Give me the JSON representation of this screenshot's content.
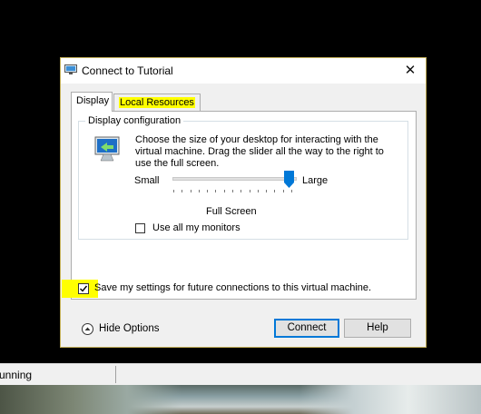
{
  "dialog": {
    "title": "Connect to Tutorial",
    "close_glyph": "✕",
    "tabs": [
      {
        "label": "Display",
        "active": true
      },
      {
        "label": "Local Resources",
        "active": false,
        "highlighted": true
      }
    ],
    "group_title": "Display configuration",
    "description": "Choose the size of your desktop for interacting with the virtual machine. Drag the slider all the way to the right to use the full screen.",
    "slider": {
      "min_label": "Small",
      "max_label": "Large",
      "value_label": "Full Screen",
      "value_fraction": 1.0
    },
    "use_all_monitors": {
      "label": "Use all my monitors",
      "checked": false
    },
    "save_settings": {
      "label": "Save my settings for future connections to this virtual machine.",
      "checked": true,
      "highlighted": true
    },
    "hide_options_label": "Hide Options",
    "connect_label": "Connect",
    "help_label": "Help"
  },
  "statusbar": {
    "text": "unning"
  },
  "colors": {
    "accent": "#0078d7",
    "highlight": "#ffff00",
    "dialog_bg": "#f0f0f0"
  },
  "icons": [
    "computer-icon",
    "monitor-icon",
    "close-icon",
    "chevron-up-icon",
    "check-icon"
  ]
}
